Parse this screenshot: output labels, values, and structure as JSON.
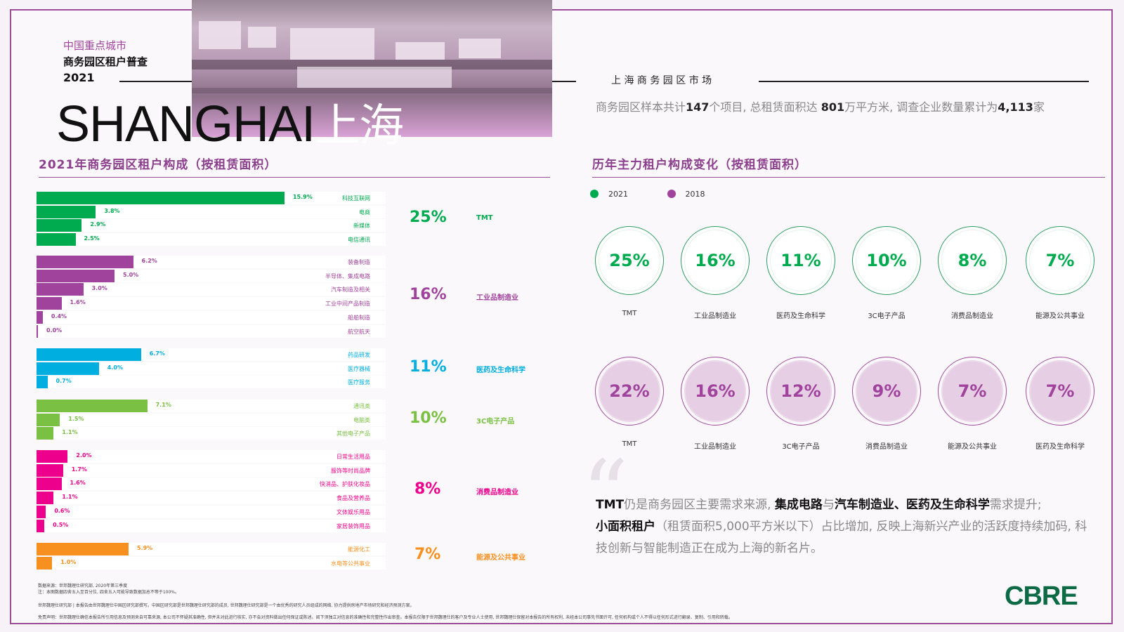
{
  "header": {
    "line1": "中国重点城市",
    "line2": "商务园区租户普查",
    "year": "2021",
    "city_en": "SHANGHAI",
    "city_cn": "上海",
    "market": "上 海 商 务 园 区 市 场"
  },
  "intro": {
    "t1": "商务园区样本共计",
    "n1": "147",
    "t2": "个项目, 总租赁面积达 ",
    "n2": "801",
    "t3": "万平方米, 调查企业数量累计为",
    "n3": "4,113",
    "t4": "家"
  },
  "left_title": "2021年商务园区租户构成（按租赁面积）",
  "right_title": "历年主力租户构成变化（按租赁面积）",
  "colors": {
    "tmt": "#00ab4f",
    "ind": "#a0439c",
    "med": "#00aee0",
    "c3": "#7ac143",
    "cons": "#ec008c",
    "energy": "#f7901e"
  },
  "chart_data": [
    {
      "type": "bar",
      "orientation": "horizontal",
      "title": "2021年商务园区租户构成（按租赁面积）",
      "xlim": [
        0,
        26
      ],
      "groups": [
        {
          "name": "TMT",
          "total": "25%",
          "color_key": "tmt",
          "items": [
            {
              "label": "科技互联网",
              "value": 15.9,
              "text": "15.9%"
            },
            {
              "label": "电商",
              "value": 3.8,
              "text": "3.8%"
            },
            {
              "label": "新媒体",
              "value": 2.9,
              "text": "2.9%"
            },
            {
              "label": "电信通讯",
              "value": 2.5,
              "text": "2.5%"
            }
          ]
        },
        {
          "name": "工业品制造业",
          "total": "16%",
          "color_key": "ind",
          "items": [
            {
              "label": "装备制造",
              "value": 6.2,
              "text": "6.2%"
            },
            {
              "label": "半导体、集成电路",
              "value": 5.0,
              "text": "5.0%"
            },
            {
              "label": "汽车制造及相关",
              "value": 3.0,
              "text": "3.0%"
            },
            {
              "label": "工业中间产品制造",
              "value": 1.6,
              "text": "1.6%"
            },
            {
              "label": "船舶制造",
              "value": 0.4,
              "text": "0.4%"
            },
            {
              "label": "航空航天",
              "value": 0.0,
              "text": "0.0%"
            }
          ]
        },
        {
          "name": "医药及生命科学",
          "total": "11%",
          "color_key": "med",
          "items": [
            {
              "label": "药品研发",
              "value": 6.7,
              "text": "6.7%"
            },
            {
              "label": "医疗器械",
              "value": 4.0,
              "text": "4.0%"
            },
            {
              "label": "医疗服务",
              "value": 0.7,
              "text": "0.7%"
            }
          ]
        },
        {
          "name": "3C电子产品",
          "total": "10%",
          "color_key": "c3",
          "items": [
            {
              "label": "通讯类",
              "value": 7.1,
              "text": "7.1%"
            },
            {
              "label": "电脑类",
              "value": 1.5,
              "text": "1.5%"
            },
            {
              "label": "其他电子产品",
              "value": 1.1,
              "text": "1.1%"
            }
          ]
        },
        {
          "name": "消费品制造业",
          "total": "8%",
          "color_key": "cons",
          "items": [
            {
              "label": "日常生活用品",
              "value": 2.0,
              "text": "2.0%"
            },
            {
              "label": "服饰等时尚品牌",
              "value": 1.7,
              "text": "1.7%"
            },
            {
              "label": "快消品、护肤化妆品",
              "value": 1.6,
              "text": "1.6%"
            },
            {
              "label": "食品及营养品",
              "value": 1.1,
              "text": "1.1%"
            },
            {
              "label": "文体娱乐用品",
              "value": 0.6,
              "text": "0.6%"
            },
            {
              "label": "家居装饰用品",
              "value": 0.5,
              "text": "0.5%"
            }
          ]
        },
        {
          "name": "能源及公共事业",
          "total": "7%",
          "color_key": "energy",
          "items": [
            {
              "label": "能源化工",
              "value": 5.9,
              "text": "5.9%"
            },
            {
              "label": "水电等公共事业",
              "value": 1.0,
              "text": "1.0%"
            }
          ]
        }
      ]
    },
    {
      "type": "table",
      "title": "历年主力租户构成变化（按租赁面积）",
      "legend": [
        "2021",
        "2018"
      ],
      "legend_placement": "top-left",
      "series": [
        {
          "name": "2021",
          "values": [
            {
              "label": "TMT",
              "text": "25%"
            },
            {
              "label": "工业品制造业",
              "text": "16%"
            },
            {
              "label": "医药及生命科学",
              "text": "11%"
            },
            {
              "label": "3C电子产品",
              "text": "10%"
            },
            {
              "label": "消费品制造业",
              "text": "8%"
            },
            {
              "label": "能源及公共事业",
              "text": "7%"
            }
          ]
        },
        {
          "name": "2018",
          "values": [
            {
              "label": "TMT",
              "text": "22%"
            },
            {
              "label": "工业品制造业",
              "text": "16%"
            },
            {
              "label": "3C电子产品",
              "text": "12%"
            },
            {
              "label": "消费品制造业",
              "text": "9%"
            },
            {
              "label": "能源及公共事业",
              "text": "7%"
            },
            {
              "label": "医药及生命科学",
              "text": "7%"
            }
          ]
        }
      ]
    }
  ],
  "quote": {
    "p1": "TMT",
    "p2": "仍是商务园区主要需求来源, ",
    "p3": "集成电路",
    "p4": "与",
    "p5": "汽车制造业、医药及生命科学",
    "p6": "需求提升;",
    "p7": "小面积租户",
    "p8": "（租赁面积5,000平方米以下）占比增加, 反映上海新兴产业的活跃度持续加码, 科技创新与智能制造正在成为上海的新名片。"
  },
  "footer": {
    "src1": "数据来源：世邦魏理仕研究部, 2020年第三季度",
    "src2": "注：本图数据四舍五入至百分位, 四舍五入可能导致数据加总不等于100%。",
    "about": "世邦魏理仕研究部 | 本报告由世邦魏理仕中国区研究部撰写。中国区研究部是世邦魏理仕研究部的成员, 世邦魏理仕研究部是一个由优秀的研究人员组成的网络, 协力提供房地产市场研究和经济预测方案。",
    "disclaimer": "免责声明：世邦魏理仕确信本报告所引用信息及预测来自可靠来源, 本公司不怀疑其准确性, 但并未对此进行核实, 亦不会对资料做出任何保证或陈述。阅下须独立对信息的准确性和完整性作出审查。本报告仅限于世邦魏理仕的客户及专业人士使用, 世邦魏理仕保留对本报告的所有权利, 未经本公司事先书面许可, 任何机构或个人不得以任何形式进行翻录、复制、引用和转载。"
  },
  "logo": "CBRE"
}
